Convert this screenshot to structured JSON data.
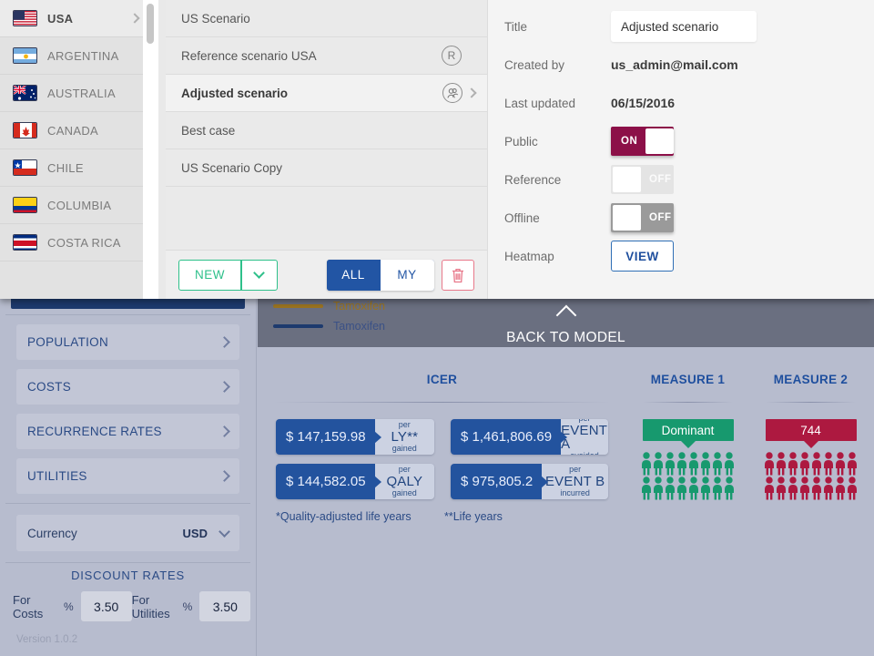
{
  "sidebar": {
    "sections": [
      {
        "label": "POPULATION"
      },
      {
        "label": "COSTS"
      },
      {
        "label": "RECURRENCE RATES"
      },
      {
        "label": "UTILITIES"
      }
    ],
    "currency": {
      "label": "Currency",
      "value": "USD"
    },
    "discount": {
      "title": "DISCOUNT RATES",
      "costs_label": "For Costs",
      "costs_pct": "%",
      "costs_value": "3.50",
      "utilities_label": "For Utilities",
      "utilities_pct": "%",
      "utilities_value": "3.50"
    },
    "version": "Version 1.0.2"
  },
  "main": {
    "legend": [
      {
        "label": "Tamoxifen",
        "color": "#9a7320"
      },
      {
        "label": "Tamoxifen",
        "color": "#1d3a6e"
      }
    ],
    "back_to_model": "BACK TO MODEL",
    "icer": {
      "title": "ICER",
      "cards": [
        {
          "value": "$ 147,159.98",
          "per": "per",
          "unit": "LY**",
          "suffix": "gained"
        },
        {
          "value": "$ 1,461,806.69",
          "per": "per",
          "unit": "EVENT A",
          "suffix": "avoided"
        },
        {
          "value": "$ 144,582.05",
          "per": "per",
          "unit": "QALY",
          "suffix": "gained"
        },
        {
          "value": "$ 975,805.2",
          "per": "per",
          "unit": "EVENT B",
          "suffix": "incurred"
        }
      ],
      "footnote_1": "*Quality-adjusted life years",
      "footnote_2": "**Life years"
    },
    "measure1": {
      "title": "MEASURE 1",
      "badge": "Dominant",
      "badge_color": "#17996e",
      "figures": 16,
      "rows": 2
    },
    "measure2": {
      "title": "MEASURE 2",
      "badge": "744",
      "badge_color": "#ad1940",
      "figures": 16,
      "rows": 2
    }
  },
  "modal": {
    "countries": [
      {
        "label": "USA",
        "active": true
      },
      {
        "label": "ARGENTINA",
        "active": false
      },
      {
        "label": "AUSTRALIA",
        "active": false
      },
      {
        "label": "CANADA",
        "active": false
      },
      {
        "label": "CHILE",
        "active": false
      },
      {
        "label": "COLUMBIA",
        "active": false
      },
      {
        "label": "COSTA RICA",
        "active": false
      }
    ],
    "scenarios": [
      {
        "name": "US Scenario",
        "icon": "",
        "selected": false,
        "arrow": false
      },
      {
        "name": "Reference scenario USA",
        "icon": "R",
        "selected": false,
        "arrow": false
      },
      {
        "name": "Adjusted scenario",
        "icon": "people",
        "selected": true,
        "arrow": true
      },
      {
        "name": "Best case",
        "icon": "",
        "selected": false,
        "arrow": false
      },
      {
        "name": "US Scenario Copy",
        "icon": "",
        "selected": false,
        "arrow": false
      }
    ],
    "toolbar": {
      "new_label": "NEW",
      "seg_all": "ALL",
      "seg_my": "MY",
      "delete_icon": "trash-icon"
    },
    "details": {
      "title_label": "Title",
      "title_value": "Adjusted scenario",
      "created_by_label": "Created by",
      "created_by_value": "us_admin@mail.com",
      "last_updated_label": "Last updated",
      "last_updated_value": "06/15/2016",
      "public_label": "Public",
      "public_state": "ON",
      "reference_label": "Reference",
      "reference_state": "OFF",
      "offline_label": "Offline",
      "offline_state": "OFF",
      "heatmap_label": "Heatmap",
      "heatmap_button": "VIEW"
    }
  }
}
